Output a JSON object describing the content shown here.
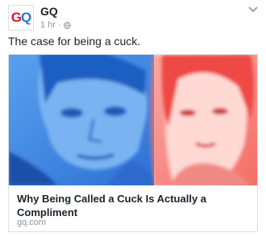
{
  "post": {
    "page_name": "GQ",
    "avatar_text_1": "G",
    "avatar_text_2": "Q",
    "time": "1 hr",
    "separator": "·",
    "privacy_icon": "globe-icon",
    "status_text": "The case for being a cuck."
  },
  "link_preview": {
    "title": "Why Being Called a Cuck Is Actually a Compliment",
    "domain": "gq.com",
    "image_colors": {
      "left_tint": "#2f7de1",
      "right_tint": "#f25c5c"
    }
  },
  "menu": {
    "icon": "chevron-down-icon"
  },
  "colors": {
    "text": "#1d2129",
    "meta": "#90949c",
    "border": "#dddfe2",
    "brand_red": "#e8102a",
    "brand_blue": "#1e7ad6"
  }
}
